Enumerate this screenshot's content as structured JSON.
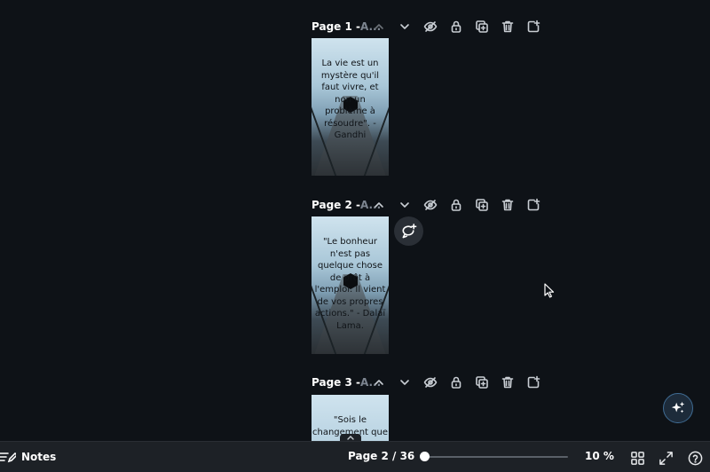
{
  "pages": [
    {
      "title": "Page 1 - ",
      "subtitle": "A...",
      "quote": "La vie est un mystère qu'il faut vivre, et non un problème à résoudre\". - Gandhi"
    },
    {
      "title": "Page 2 - ",
      "subtitle": "A...",
      "quote": "\"Le bonheur n'est pas quelque chose de prêt à l'emploi. Il vient de vos propres actions.\" - Dalaï Lama."
    },
    {
      "title": "Page 3 - ",
      "subtitle": "A...",
      "quote": "\"Sois le changement que"
    }
  ],
  "page_actions": [
    "chevron-up-icon",
    "chevron-down-icon",
    "hide-icon",
    "lock-icon",
    "duplicate-icon",
    "delete-icon",
    "add-page-icon"
  ],
  "bottombar": {
    "notes_label": "Notes",
    "page_indicator": "Page 2 / 36",
    "zoom_label": "10 %",
    "zoom_fraction": 0.0
  },
  "colors": {
    "background": "#0e1217",
    "bar": "#1d2126",
    "accent": "#3f6b93"
  }
}
